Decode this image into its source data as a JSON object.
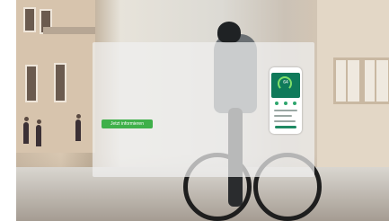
{
  "hero": {
    "cta_label": "Jetzt informieren",
    "phone_gauge_value": "64"
  },
  "colors": {
    "cta_green": "#3fb04a",
    "app_green": "#0f7a5a",
    "gauge_green": "#7fe06a"
  }
}
